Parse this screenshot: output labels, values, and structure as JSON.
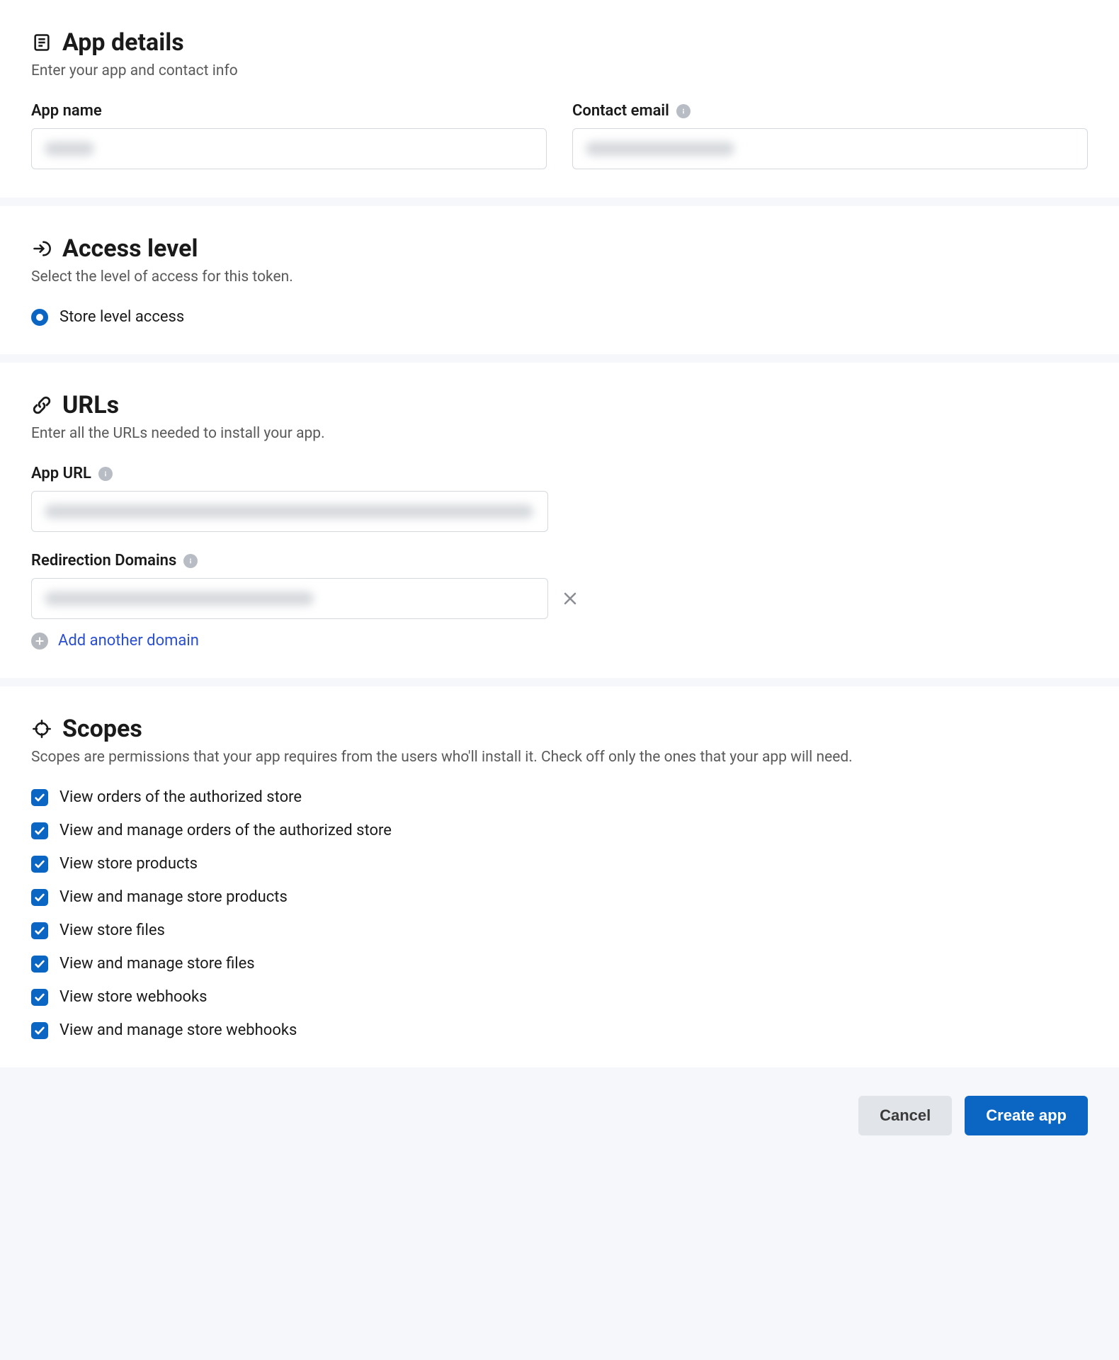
{
  "app_details": {
    "title": "App details",
    "subtitle": "Enter your app and contact info",
    "app_name_label": "App name",
    "contact_email_label": "Contact email"
  },
  "access_level": {
    "title": "Access level",
    "subtitle": "Select the level of access for this token.",
    "option_store_label": "Store level access"
  },
  "urls": {
    "title": "URLs",
    "subtitle": "Enter all the URLs needed to install your app.",
    "app_url_label": "App URL",
    "redirection_label": "Redirection Domains",
    "add_another_label": "Add another domain"
  },
  "scopes": {
    "title": "Scopes",
    "subtitle": "Scopes are permissions that your app requires from the users who'll install it. Check off only the ones that your app will need.",
    "items": [
      {
        "label": "View orders of the authorized store",
        "checked": true
      },
      {
        "label": "View and manage orders of the authorized store",
        "checked": true
      },
      {
        "label": "View store products",
        "checked": true
      },
      {
        "label": "View and manage store products",
        "checked": true
      },
      {
        "label": "View store files",
        "checked": true
      },
      {
        "label": "View and manage store files",
        "checked": true
      },
      {
        "label": "View store webhooks",
        "checked": true
      },
      {
        "label": "View and manage store webhooks",
        "checked": true
      }
    ]
  },
  "footer": {
    "cancel_label": "Cancel",
    "create_label": "Create app"
  }
}
